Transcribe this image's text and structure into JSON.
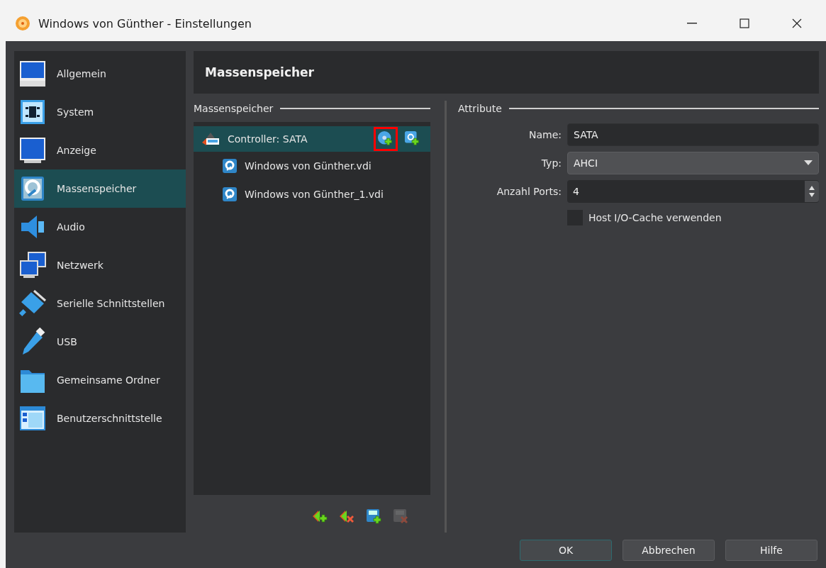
{
  "window": {
    "title": "Windows von Günther - Einstellungen"
  },
  "sidebar": {
    "items": [
      {
        "label": "Allgemein",
        "kind": "general",
        "selected": false
      },
      {
        "label": "System",
        "kind": "system",
        "selected": false
      },
      {
        "label": "Anzeige",
        "kind": "display",
        "selected": false
      },
      {
        "label": "Massenspeicher",
        "kind": "storage",
        "selected": true
      },
      {
        "label": "Audio",
        "kind": "audio",
        "selected": false
      },
      {
        "label": "Netzwerk",
        "kind": "network",
        "selected": false
      },
      {
        "label": "Serielle Schnittstellen",
        "kind": "serial",
        "selected": false
      },
      {
        "label": "USB",
        "kind": "usb",
        "selected": false
      },
      {
        "label": "Gemeinsame Ordner",
        "kind": "folder",
        "selected": false
      },
      {
        "label": "Benutzerschnittstelle",
        "kind": "ui",
        "selected": false
      }
    ]
  },
  "header": {
    "title": "Massenspeicher"
  },
  "storage": {
    "group_label": "Massenspeicher",
    "tree": [
      {
        "label": "Controller: SATA",
        "selected": true,
        "actions": [
          {
            "kind": "add-optical",
            "highlighted": true
          },
          {
            "kind": "add-disk",
            "highlighted": false
          }
        ],
        "children": [
          {
            "label": "Windows von Günther.vdi",
            "selected": false
          },
          {
            "label": "Windows von Günther_1.vdi",
            "selected": false
          }
        ]
      }
    ],
    "toolbar": [
      {
        "kind": "add-controller",
        "disabled": false
      },
      {
        "kind": "remove-controller",
        "disabled": false
      },
      {
        "kind": "add-attachment",
        "disabled": false
      },
      {
        "kind": "remove-attachment",
        "disabled": true
      }
    ]
  },
  "attributes": {
    "group_label": "Attribute",
    "name": {
      "label": "Name:",
      "value": "SATA"
    },
    "type": {
      "label": "Typ:",
      "value": "AHCI"
    },
    "ports": {
      "label": "Anzahl Ports:",
      "value": "4"
    },
    "cache": {
      "label": "Host I/O-Cache verwenden",
      "checked": false
    }
  },
  "buttons": [
    {
      "label": "OK",
      "default": true
    },
    {
      "label": "Abbrechen",
      "default": false
    },
    {
      "label": "Hilfe",
      "default": false
    }
  ]
}
